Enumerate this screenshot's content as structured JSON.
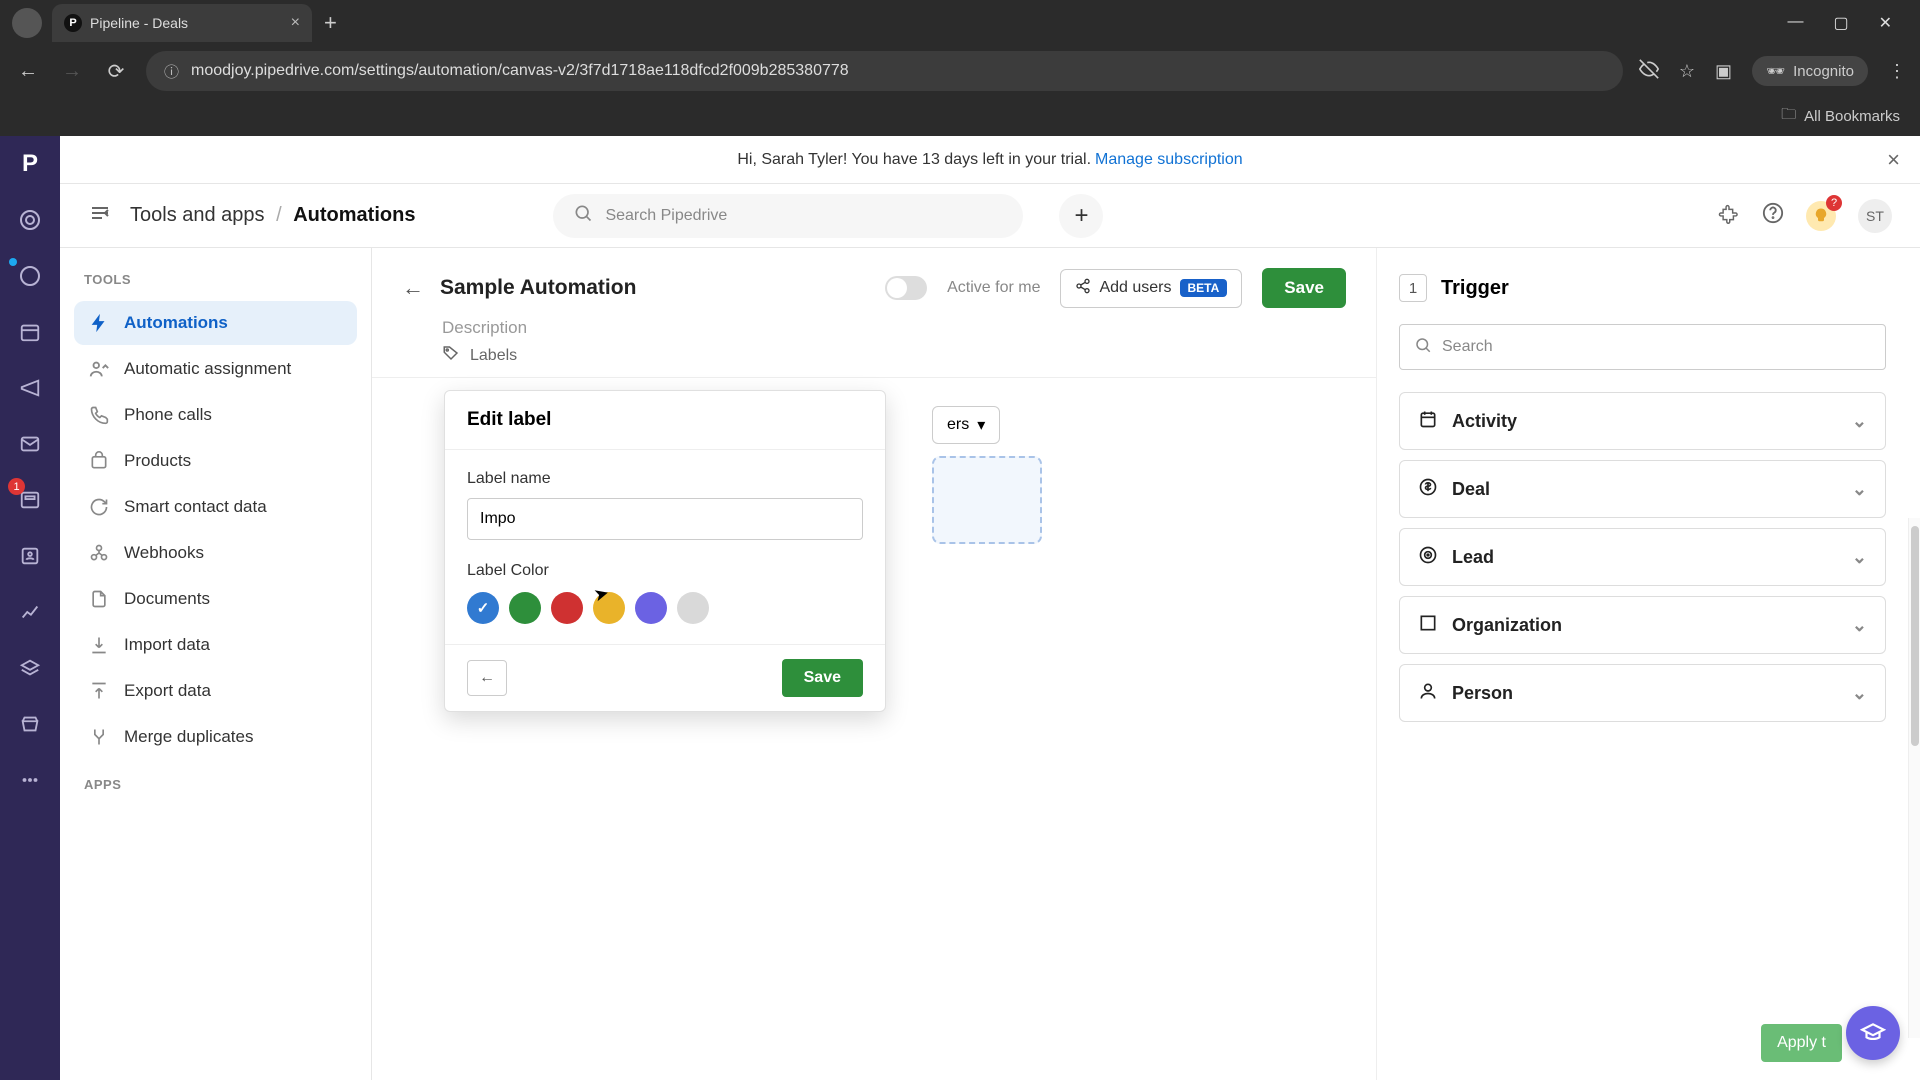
{
  "browser": {
    "tab_title": "Pipeline - Deals",
    "url": "moodjoy.pipedrive.com/settings/automation/canvas-v2/3f7d1718ae118dfcd2f009b285380778",
    "incognito_label": "Incognito",
    "bookmarks_label": "All Bookmarks"
  },
  "banner": {
    "text_pre": "Hi, Sarah Tyler! You have 13 days left in your trial.",
    "link": "Manage subscription"
  },
  "topbar": {
    "breadcrumb_root": "Tools and apps",
    "breadcrumb_current": "Automations",
    "search_placeholder": "Search Pipedrive",
    "avatar_initials": "ST"
  },
  "sidebar": {
    "heading_tools": "TOOLS",
    "items": [
      {
        "label": "Automations"
      },
      {
        "label": "Automatic assignment"
      },
      {
        "label": "Phone calls"
      },
      {
        "label": "Products"
      },
      {
        "label": "Smart contact data"
      },
      {
        "label": "Webhooks"
      },
      {
        "label": "Documents"
      },
      {
        "label": "Import data"
      },
      {
        "label": "Export data"
      },
      {
        "label": "Merge duplicates"
      }
    ],
    "heading_apps": "APPS"
  },
  "left_rail_badge": "1",
  "page": {
    "title": "Sample Automation",
    "toggle_label": "Active for me",
    "add_users": "Add users",
    "beta": "BETA",
    "save": "Save",
    "description_placeholder": "Description",
    "labels_label": "Labels",
    "triggers_chip": "ers"
  },
  "popover": {
    "title": "Edit label",
    "name_label": "Label name",
    "name_value": "Impo",
    "color_label": "Label Color",
    "colors": [
      "#317ad1",
      "#2e8f3b",
      "#cf3131",
      "#e9b32a",
      "#6b62e3",
      "#d9d9d9"
    ],
    "selected_color_index": 0,
    "save": "Save"
  },
  "right_panel": {
    "step_num": "1",
    "title": "Trigger",
    "search_placeholder": "Search",
    "items": [
      {
        "label": "Activity"
      },
      {
        "label": "Deal"
      },
      {
        "label": "Lead"
      },
      {
        "label": "Organization"
      },
      {
        "label": "Person"
      }
    ],
    "apply": "Apply t"
  },
  "tip_badge": "?"
}
